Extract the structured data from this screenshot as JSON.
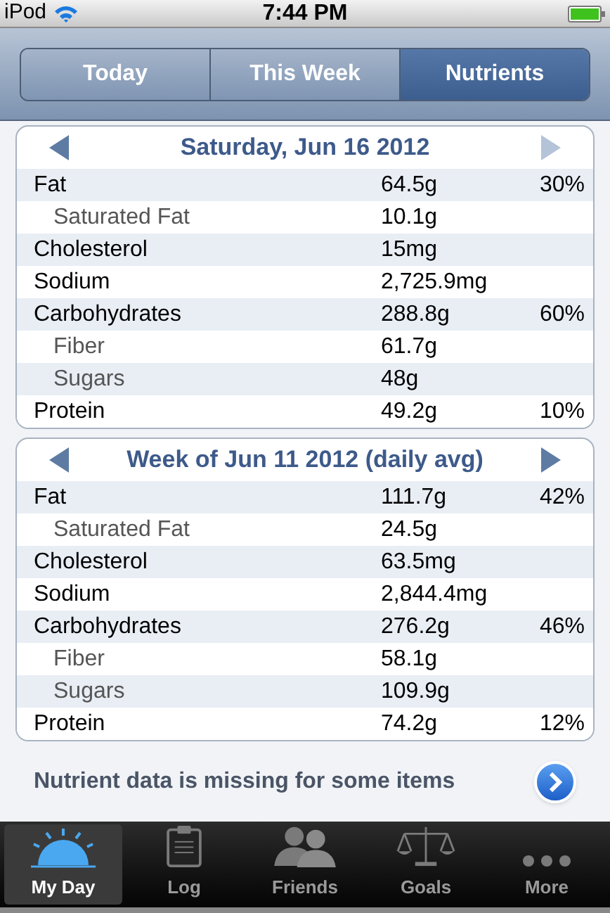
{
  "status_bar": {
    "carrier": "iPod",
    "time": "7:44 PM"
  },
  "segments": [
    {
      "label": "Today",
      "selected": false
    },
    {
      "label": "This Week",
      "selected": false
    },
    {
      "label": "Nutrients",
      "selected": true
    }
  ],
  "cards": [
    {
      "title": "Saturday, Jun 16 2012",
      "prev_disabled": false,
      "next_disabled": true,
      "rows": [
        {
          "kind": "main",
          "name": "Fat",
          "amount": "64.5g",
          "percent": "30%"
        },
        {
          "kind": "sub",
          "name": "Saturated Fat",
          "amount": "10.1g"
        },
        {
          "kind": "main",
          "name": "Cholesterol",
          "amount": "15mg"
        },
        {
          "kind": "main",
          "name": "Sodium",
          "amount": "2,725.9mg"
        },
        {
          "kind": "main",
          "name": "Carbohydrates",
          "amount": "288.8g",
          "percent": "60%"
        },
        {
          "kind": "sub",
          "name": "Fiber",
          "amount": "61.7g"
        },
        {
          "kind": "sub",
          "name": "Sugars",
          "amount": "48g"
        },
        {
          "kind": "main",
          "name": "Protein",
          "amount": "49.2g",
          "percent": "10%"
        }
      ]
    },
    {
      "title": "Week of Jun 11 2012 (daily avg)",
      "prev_disabled": false,
      "next_disabled": false,
      "rows": [
        {
          "kind": "main",
          "name": "Fat",
          "amount": "111.7g",
          "percent": "42%"
        },
        {
          "kind": "sub",
          "name": "Saturated Fat",
          "amount": "24.5g"
        },
        {
          "kind": "main",
          "name": "Cholesterol",
          "amount": "63.5mg"
        },
        {
          "kind": "main",
          "name": "Sodium",
          "amount": "2,844.4mg"
        },
        {
          "kind": "main",
          "name": "Carbohydrates",
          "amount": "276.2g",
          "percent": "46%"
        },
        {
          "kind": "sub",
          "name": "Fiber",
          "amount": "58.1g"
        },
        {
          "kind": "sub",
          "name": "Sugars",
          "amount": "109.9g"
        },
        {
          "kind": "main",
          "name": "Protein",
          "amount": "74.2g",
          "percent": "12%"
        }
      ]
    }
  ],
  "notice": "Nutrient data is missing for some items",
  "tab_bar": [
    {
      "kind": "sun",
      "label": "My Day",
      "selected": true
    },
    {
      "kind": "clipboard",
      "label": "Log",
      "selected": false
    },
    {
      "kind": "people",
      "label": "Friends",
      "selected": false
    },
    {
      "kind": "scale",
      "label": "Goals",
      "selected": false
    },
    {
      "kind": "dots",
      "label": "More",
      "selected": false
    }
  ]
}
